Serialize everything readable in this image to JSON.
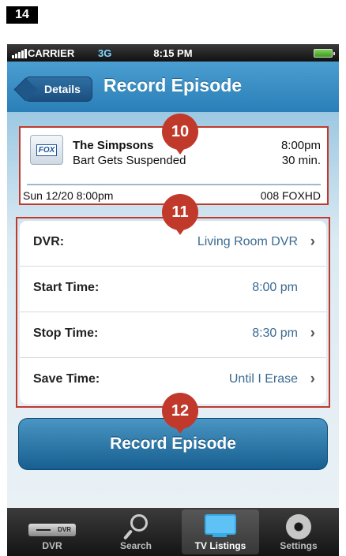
{
  "page_badge": "14",
  "status_bar": {
    "carrier": "CARRIER",
    "network": "3G",
    "time": "8:15 PM"
  },
  "nav": {
    "back_label": "Details",
    "title": "Record Episode"
  },
  "program": {
    "channel_logo_text": "FOX",
    "show_title": "The Simpsons",
    "episode_title": "Bart Gets Suspended",
    "air_time": "8:00pm",
    "duration": "30 min.",
    "air_date": "Sun 12/20 8:00pm",
    "channel": "008 FOXHD"
  },
  "settings": [
    {
      "label": "DVR:",
      "value": "Living Room DVR",
      "chevron": true
    },
    {
      "label": "Start Time:",
      "value": "8:00 pm",
      "chevron": false
    },
    {
      "label": "Stop Time:",
      "value": "8:30 pm",
      "chevron": true
    },
    {
      "label": "Save Time:",
      "value": "Until I Erase",
      "chevron": true
    }
  ],
  "chevron_glyph": "›",
  "record_button_label": "Record Episode",
  "callouts": [
    "10",
    "11",
    "12"
  ],
  "tabs": [
    {
      "label": "DVR",
      "icon": "dvr-icon"
    },
    {
      "label": "Search",
      "icon": "search-icon"
    },
    {
      "label": "TV Listings",
      "icon": "tv-icon",
      "selected": true
    },
    {
      "label": "Settings",
      "icon": "gear-icon"
    }
  ],
  "colors": {
    "callout_red": "#c0392b",
    "nav_blue": "#2a7fb8",
    "value_blue": "#3a6a92"
  }
}
